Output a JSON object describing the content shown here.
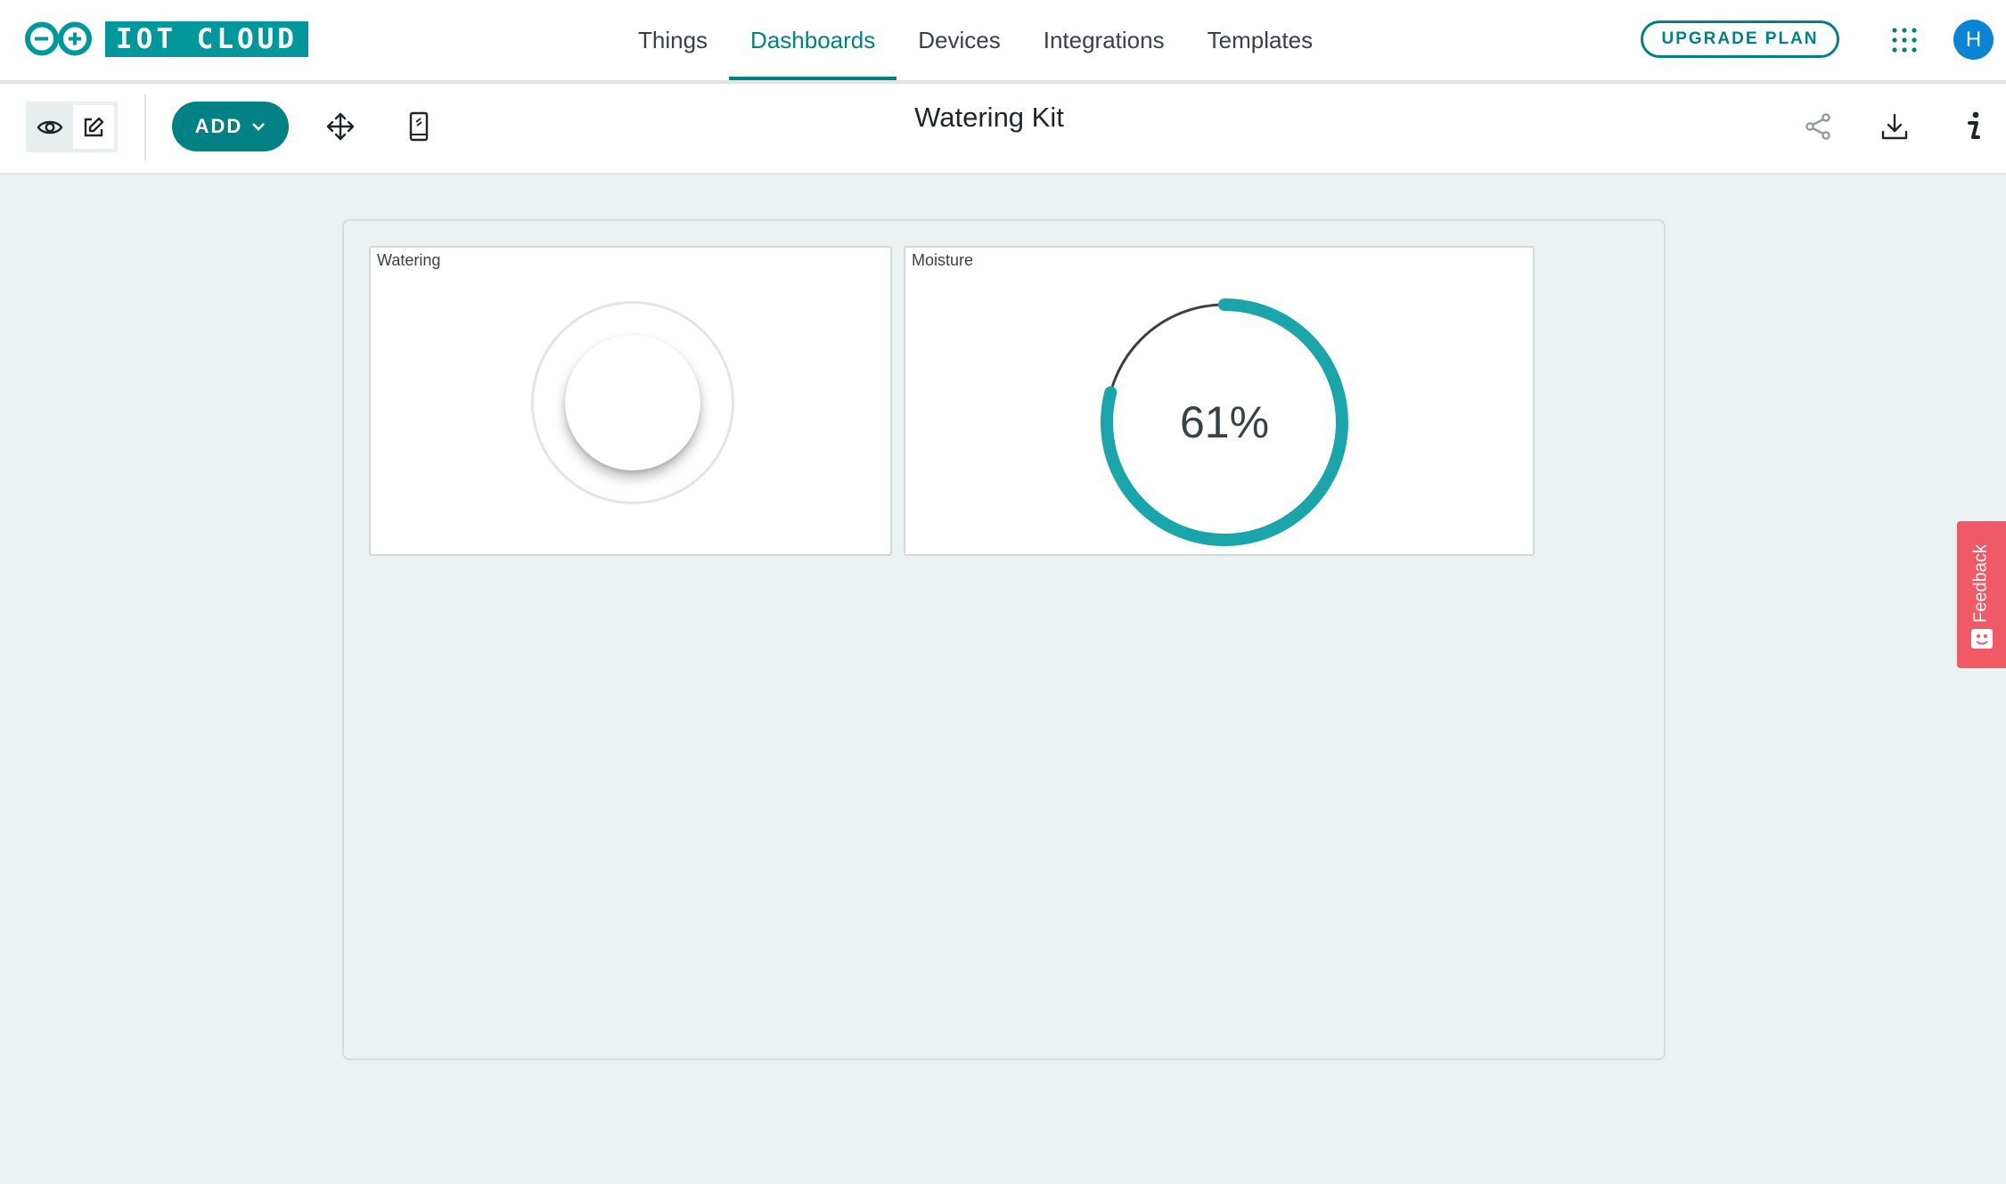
{
  "app": {
    "logo_text": "IOT CLOUD",
    "brand_color": "#00979d"
  },
  "nav": {
    "tabs": [
      {
        "label": "Things",
        "active": false
      },
      {
        "label": "Dashboards",
        "active": true
      },
      {
        "label": "Devices",
        "active": false
      },
      {
        "label": "Integrations",
        "active": false
      },
      {
        "label": "Templates",
        "active": false
      }
    ],
    "upgrade_label": "UPGRADE PLAN",
    "apps_icon": "apps-grid-icon",
    "avatar_initial": "H"
  },
  "toolbar": {
    "view_icon": "eye-icon",
    "edit_icon": "pencil-icon",
    "add_label": "ADD",
    "move_icon": "move-arrows-icon",
    "mobile_icon": "mobile-phone-icon",
    "title": "Watering Kit",
    "share_icon": "share-icon",
    "download_icon": "download-icon",
    "info_icon": "info-icon"
  },
  "widgets": {
    "watering": {
      "title": "Watering",
      "type": "push-button"
    },
    "moisture": {
      "title": "Moisture",
      "type": "gauge",
      "value": 61,
      "display": "61%",
      "accent": "#1aa5aa"
    }
  },
  "feedback": {
    "label": "Feedback",
    "color": "#f05a67"
  }
}
